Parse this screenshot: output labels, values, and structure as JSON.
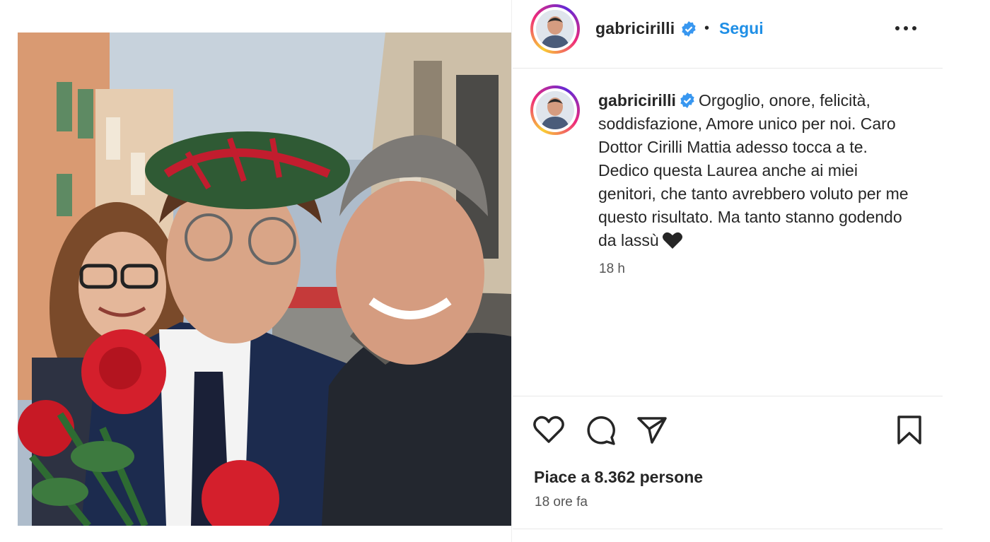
{
  "post": {
    "username": "gabricirilli",
    "follow_label": "Segui",
    "separator": "•",
    "caption_user": "gabricirilli",
    "caption_text": "Orgoglio, onore, felicità, soddisfazione, Amore unico per noi. Caro Dottor Cirilli Mattia adesso tocca a te. Dedico questa Laurea anche ai miei genitori, che tanto avrebbero voluto per me questo risultato. Ma tanto stanno godendo da lassù",
    "caption_time": "18 h",
    "likes_text": "Piace a 8.362 persone",
    "posted_ago": "18 ore fa"
  },
  "icons": {
    "more": "more-options-icon",
    "verified": "verified-badge-icon",
    "like": "heart-outline-icon",
    "comment": "comment-icon",
    "share": "send-icon",
    "save": "bookmark-icon",
    "caption_emoji": "black-heart-icon"
  },
  "colors": {
    "follow": "#1f8fe6",
    "verified": "#3897f0",
    "text": "#262626",
    "muted": "#555555",
    "divider": "#e8e8e8"
  }
}
